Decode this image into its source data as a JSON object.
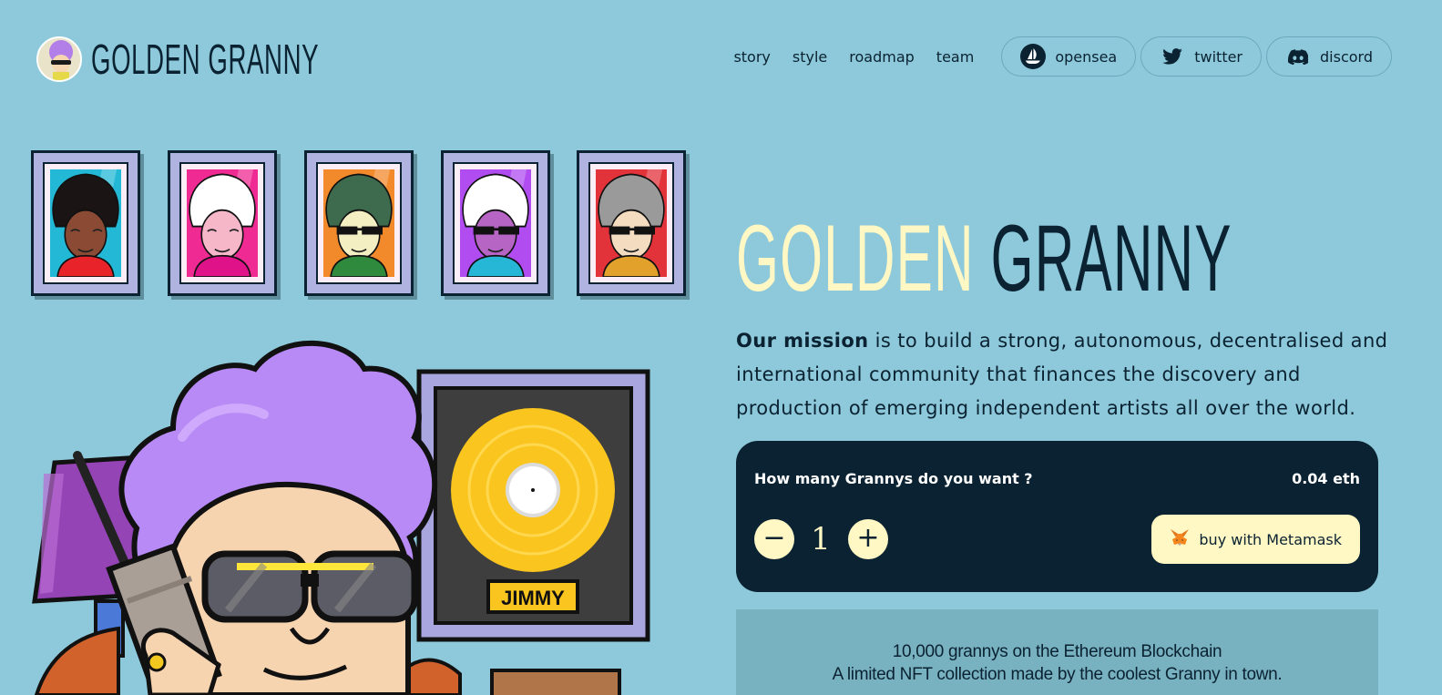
{
  "brand": {
    "name": "GOLDEN GRANNY"
  },
  "nav": {
    "links": [
      "story",
      "style",
      "roadmap",
      "team"
    ],
    "socials": [
      {
        "label": "opensea",
        "icon": "opensea-icon"
      },
      {
        "label": "twitter",
        "icon": "twitter-icon"
      },
      {
        "label": "discord",
        "icon": "discord-icon"
      }
    ]
  },
  "gallery": {
    "portraits": [
      {
        "bg": "#23b9d6",
        "hair": "#1b1414",
        "skin": "#8a4a33",
        "shirt": "#e8232a",
        "glasses": false
      },
      {
        "bg": "#ef2a92",
        "hair": "#ffffff",
        "skin": "#f6b8c8",
        "shirt": "#e0128a",
        "glasses": false
      },
      {
        "bg": "#f28a2c",
        "hair": "#3e6b4d",
        "skin": "#f3efc3",
        "shirt": "#2f8a3e",
        "glasses": true
      },
      {
        "bg": "#b04cf0",
        "hair": "#ffffff",
        "skin": "#b665c4",
        "shirt": "#26b6d6",
        "glasses": true
      },
      {
        "bg": "#e2323a",
        "hair": "#9a9a9a",
        "skin": "#f4dcc1",
        "shirt": "#e2a12b",
        "glasses": true
      }
    ]
  },
  "scene": {
    "record_label": "JIMMY",
    "colors": {
      "hair": "#b88af6",
      "lamp": "#9544b5",
      "record": "#f9c51e",
      "frame": "#a9a5df"
    }
  },
  "hero": {
    "title_gold": "GOLDEN",
    "title_dark": "GRANNY"
  },
  "mission": {
    "lead": "Our mission",
    "text": " is to build a strong, autonomous, decentralised and international community that finances the discovery and production of emerging independent artists all over the world."
  },
  "mint": {
    "question": "How many Grannys do you want ?",
    "price": "0.04 eth",
    "quantity": "1",
    "minus_label": "−",
    "plus_label": "+",
    "buy_label": "buy with Metamask"
  },
  "info": {
    "line1": "10,000 grannys on the Ethereum Blockchain",
    "line2": "A limited NFT collection made by the coolest Granny in town."
  },
  "colors": {
    "background": "#8dc9da",
    "dark": "#0a2231",
    "cream": "#fff7c4"
  }
}
